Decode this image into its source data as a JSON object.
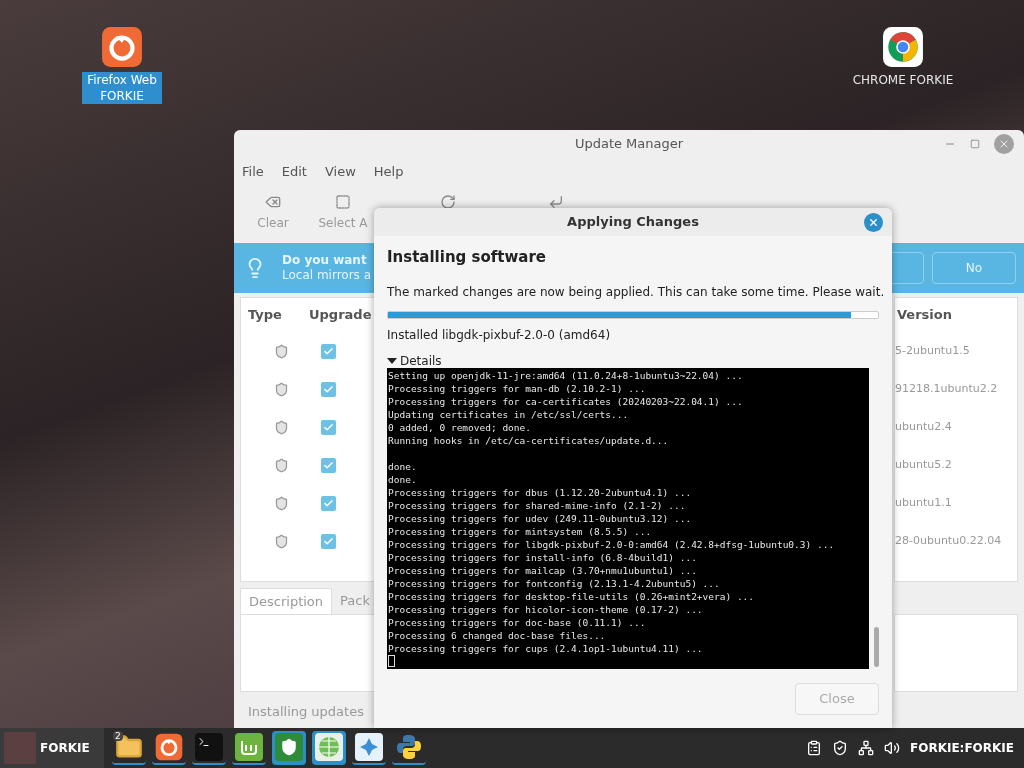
{
  "desktop_icons": [
    {
      "label": "Firefox Web FORKIE",
      "kind": "firefox",
      "selected": true
    },
    {
      "label": "CHROME FORKIE",
      "kind": "chrome",
      "selected": false
    }
  ],
  "update_manager": {
    "title": "Update Manager",
    "menu": [
      "File",
      "Edit",
      "View",
      "Help"
    ],
    "toolbar": [
      {
        "label": "Clear",
        "kind": "clear"
      },
      {
        "label": "Select A",
        "kind": "select"
      },
      {
        "kind": "refresh"
      },
      {
        "kind": "install"
      }
    ],
    "banner": {
      "title": "Do you want",
      "subtitle": "Local mirrors a",
      "buttons": [
        "No"
      ]
    },
    "columns": [
      "Type",
      "Upgrade",
      "Version"
    ],
    "rows": [
      {
        "checked": true,
        "version": "5-2ubuntu1.5"
      },
      {
        "checked": true,
        "version": "91218.1ubuntu2.2"
      },
      {
        "checked": true,
        "version": "ubuntu2.4"
      },
      {
        "checked": true,
        "version": "ubuntu5.2"
      },
      {
        "checked": true,
        "version": "ubuntu1.1"
      },
      {
        "checked": true,
        "version": "28-0ubuntu0.22.04"
      }
    ],
    "tabs": [
      {
        "label": "Description",
        "selected": true
      },
      {
        "label": "Pack",
        "selected": false
      }
    ],
    "status": "Installing updates"
  },
  "dialog": {
    "title": "Applying Changes",
    "heading": "Installing software",
    "message": "The marked changes are now being applied. This can take some time. Please wait.",
    "progress": {
      "level": 0.945
    },
    "current": "Installed libgdk-pixbuf-2.0-0 (amd64)",
    "details": {
      "label": "Details",
      "expanded": true
    },
    "log": [
      {
        "kind": "line",
        "text": "Setting up openjdk-11-jre:amd64 (11.0.24+8-1ubuntu3~22.04) ..."
      },
      {
        "kind": "line",
        "text": "Processing triggers for man-db (2.10.2-1) ..."
      },
      {
        "kind": "line",
        "text": "Processing triggers for ca-certificates (20240203~22.04.1) ..."
      },
      {
        "kind": "line",
        "text": "Updating certificates in /etc/ssl/certs..."
      },
      {
        "kind": "line",
        "text": "0 added, 0 removed; done."
      },
      {
        "kind": "line",
        "text": "Running hooks in /etc/ca-certificates/update.d..."
      },
      {
        "kind": "blank"
      },
      {
        "kind": "line",
        "text": "done."
      },
      {
        "kind": "line",
        "text": "done."
      },
      {
        "kind": "line",
        "text": "Processing triggers for dbus (1.12.20-2ubuntu4.1) ..."
      },
      {
        "kind": "line",
        "text": "Processing triggers for shared-mime-info (2.1-2) ..."
      },
      {
        "kind": "line",
        "text": "Processing triggers for udev (249.11-0ubuntu3.12) ..."
      },
      {
        "kind": "line",
        "text": "Processing triggers for mintsystem (8.5.5) ..."
      },
      {
        "kind": "line",
        "text": "Processing triggers for libgdk-pixbuf-2.0-0:amd64 (2.42.8+dfsg-1ubuntu0.3) ..."
      },
      {
        "kind": "line",
        "text": "Processing triggers for install-info (6.8-4build1) ..."
      },
      {
        "kind": "line",
        "text": "Processing triggers for mailcap (3.70+nmu1ubuntu1) ..."
      },
      {
        "kind": "line",
        "text": "Processing triggers for fontconfig (2.13.1-4.2ubuntu5) ..."
      },
      {
        "kind": "line",
        "text": "Processing triggers for desktop-file-utils (0.26+mint2+vera) ..."
      },
      {
        "kind": "line",
        "text": "Processing triggers for hicolor-icon-theme (0.17-2) ..."
      },
      {
        "kind": "line",
        "text": "Processing triggers for doc-base (0.11.1) ..."
      },
      {
        "kind": "line",
        "text": "Processing 6 changed doc-base files..."
      },
      {
        "kind": "line",
        "text": "Processing triggers for cups (2.4.1op1-1ubuntu4.11) ..."
      }
    ],
    "close": {
      "label": "Close",
      "disabled": true
    }
  },
  "taskbar": {
    "user": "FORKIE",
    "apps": [
      {
        "kind": "folder",
        "badge": "2",
        "active": false
      },
      {
        "kind": "firefox",
        "active": false
      },
      {
        "kind": "terminal",
        "active": false
      },
      {
        "kind": "mint",
        "active": false
      },
      {
        "kind": "shield",
        "active": true
      },
      {
        "kind": "globe",
        "active": true
      },
      {
        "kind": "snowflake",
        "active": false
      },
      {
        "kind": "python",
        "active": false
      }
    ],
    "session": "FORKIE:FORKIE"
  }
}
